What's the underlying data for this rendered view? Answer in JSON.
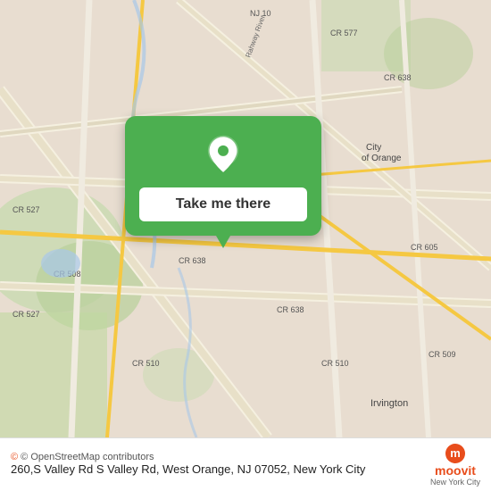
{
  "map": {
    "background_color": "#e8ddd0",
    "attribution": "© OpenStreetMap contributors"
  },
  "button_card": {
    "background_color": "#4CAF50",
    "label": "Take me there",
    "pin_color": "white"
  },
  "bottom_bar": {
    "credit_text": "© OpenStreetMap contributors",
    "address": "260,S Valley Rd S Valley Rd, West Orange, NJ 07052,",
    "city": "New York City",
    "moovit_label": "moovit",
    "moovit_sub": "New York City"
  }
}
